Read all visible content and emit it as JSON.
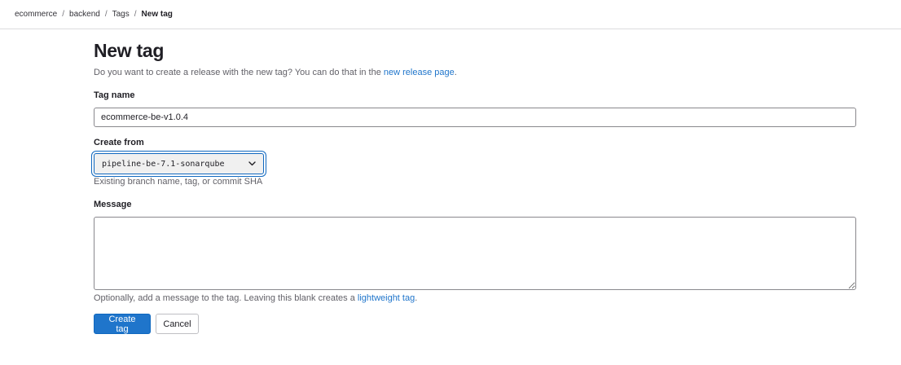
{
  "breadcrumb": {
    "items": [
      "ecommerce",
      "backend",
      "Tags",
      "New tag"
    ],
    "separator": "/"
  },
  "page": {
    "title": "New tag",
    "intro_text": "Do you want to create a release with the new tag? You can do that in the ",
    "intro_link": "new release page",
    "intro_end": "."
  },
  "form": {
    "tag_name_label": "Tag name",
    "tag_name_value": "ecommerce-be-v1.0.4",
    "create_from_label": "Create from",
    "create_from_value": "pipeline-be-7.1-sonarqube",
    "create_from_help": "Existing branch name, tag, or commit SHA",
    "message_label": "Message",
    "message_value": "",
    "message_help_text": "Optionally, add a message to the tag. Leaving this blank creates a ",
    "message_help_link": "lightweight tag",
    "message_help_end": "."
  },
  "actions": {
    "create_label": "Create tag",
    "cancel_label": "Cancel"
  },
  "colors": {
    "accent": "#1f75cb",
    "text": "#1f1e24",
    "muted": "#626168"
  }
}
